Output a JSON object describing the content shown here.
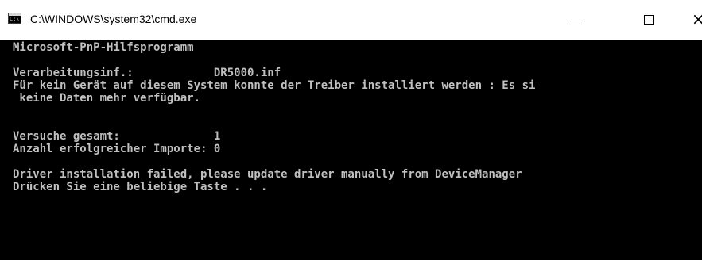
{
  "window": {
    "title": "C:\\WINDOWS\\system32\\cmd.exe",
    "icon_label": "C:\\",
    "controls": {
      "minimize": "minimize-icon",
      "maximize": "maximize-icon",
      "close": "close-icon",
      "close_glyph": "×"
    }
  },
  "console": {
    "lines": [
      "Microsoft-PnP-Hilfsprogramm",
      "",
      "Verarbeitungsinf.:            DR5000.inf",
      "Für kein Gerät auf diesem System konnte der Treiber installiert werden : Es si",
      " keine Daten mehr verfügbar.",
      "",
      "",
      "Versuche gesamt:              1",
      "Anzahl erfolgreicher Importe: 0",
      "",
      "Driver installation failed, please update driver manually from DeviceManager",
      "Drücken Sie eine beliebige Taste . . ."
    ]
  },
  "colors": {
    "console_bg": "#000000",
    "console_fg": "#c0c0c0",
    "titlebar_bg": "#ffffff"
  }
}
